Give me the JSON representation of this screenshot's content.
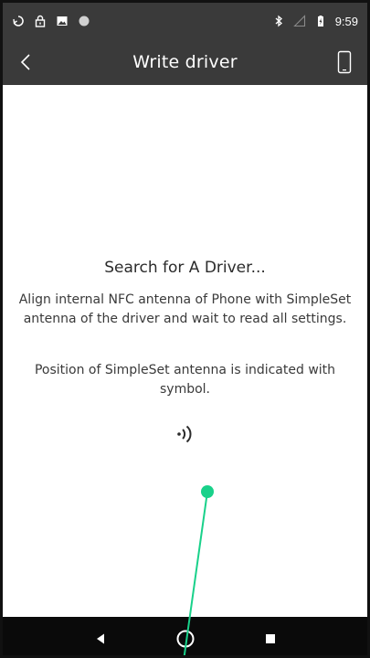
{
  "status_bar": {
    "time": "9:59",
    "icons_left": [
      "sync-icon",
      "lock-icon",
      "image-icon",
      "circle-icon"
    ],
    "icons_right": [
      "bluetooth-icon",
      "signal-icon",
      "battery-charging-icon"
    ]
  },
  "app_bar": {
    "title": "Write driver",
    "back_icon": "chevron-left-icon",
    "phone_icon": "phone-icon"
  },
  "content": {
    "heading": "Search for A Driver...",
    "paragraph1": "Align internal NFC antenna of Phone with SimpleSet antenna of the driver and wait to read all settings.",
    "paragraph2": "Position of SimpleSet antenna is indicated with symbol.",
    "symbol_icon": "nfc-signal-icon"
  },
  "nav_bar": {
    "back": "nav-back-icon",
    "home": "nav-home-icon",
    "recents": "nav-recents-icon"
  },
  "colors": {
    "bar_background": "#3a3a3a",
    "nav_background": "#0a0a0a",
    "touch_indicator": "#19d18a"
  }
}
